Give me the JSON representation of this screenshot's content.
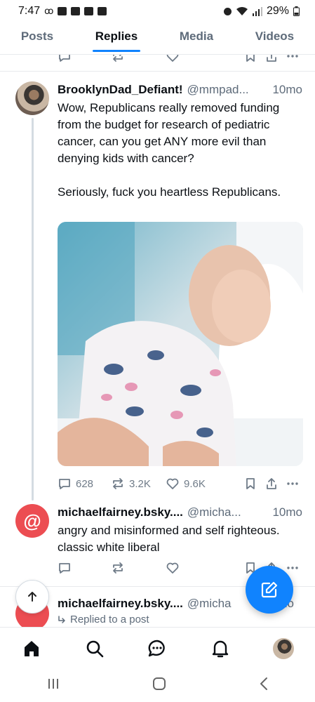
{
  "status_bar": {
    "time": "7:47",
    "battery": "29%"
  },
  "tabs": [
    {
      "label": "Posts"
    },
    {
      "label": "Replies"
    },
    {
      "label": "Media"
    },
    {
      "label": "Videos"
    }
  ],
  "active_tab": "Replies",
  "posts": [
    {
      "author": "BrooklynDad_Defiant!",
      "handle": "@mmpad...",
      "time": "10mo",
      "text": "Wow, Republicans really removed funding from the budget for research of pediatric cancer, can you get ANY more evil than denying kids with cancer?\n\nSeriously, fuck you heartless Republicans.",
      "counts": {
        "replies": "628",
        "reposts": "3.2K",
        "likes": "9.6K"
      }
    },
    {
      "author": "michaelfairney.bsky....",
      "handle": "@micha...",
      "time": "10mo",
      "text": "angry and misinformed and self righteous. classic white liberal",
      "avatar_glyph": "@"
    },
    {
      "author": "michaelfairney.bsky....",
      "handle": "@micha",
      "time": "10mo",
      "replied_to": "Replied to a post"
    }
  ],
  "colors": {
    "accent": "#1083fe",
    "muted": "#6f7b88",
    "avatar_red": "#ec4d52"
  }
}
